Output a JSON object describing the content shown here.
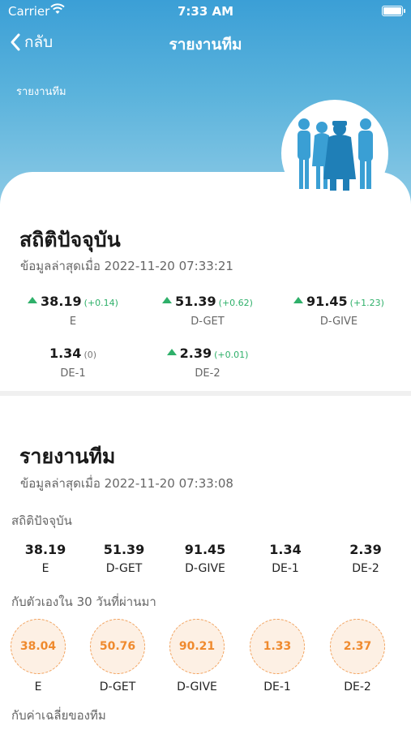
{
  "status_bar": {
    "carrier": "Carrier",
    "time": "7:33 AM"
  },
  "nav": {
    "back_label": "กลับ",
    "title": "รายงานทีม"
  },
  "hero": {
    "label": "รายงานทีม"
  },
  "current_stats": {
    "title": "สถิติปัจจุบัน",
    "updated": "ข้อมูลล่าสุดเมื่อ 2022-11-20 07:33:21",
    "items": [
      {
        "value": "38.19",
        "delta": "(+0.14)",
        "label": "E",
        "trend": "up"
      },
      {
        "value": "51.39",
        "delta": "(+0.62)",
        "label": "D-GET",
        "trend": "up"
      },
      {
        "value": "91.45",
        "delta": "(+1.23)",
        "label": "D-GIVE",
        "trend": "up"
      },
      {
        "value": "1.34",
        "delta": "(0)",
        "label": "DE-1",
        "trend": "none"
      },
      {
        "value": "2.39",
        "delta": "(+0.01)",
        "label": "DE-2",
        "trend": "up"
      }
    ]
  },
  "team_report": {
    "title": "รายงานทีม",
    "updated": "ข้อมูลล่าสุดเมื่อ 2022-11-20 07:33:08",
    "current_heading": "สถิติปัจจุบัน",
    "current": [
      {
        "value": "38.19",
        "label": "E"
      },
      {
        "value": "51.39",
        "label": "D-GET"
      },
      {
        "value": "91.45",
        "label": "D-GIVE"
      },
      {
        "value": "1.34",
        "label": "DE-1"
      },
      {
        "value": "2.39",
        "label": "DE-2"
      }
    ],
    "self_heading": "กับตัวเองใน 30 วันที่ผ่านมา",
    "self": [
      {
        "value": "38.04",
        "label": "E"
      },
      {
        "value": "50.76",
        "label": "D-GET"
      },
      {
        "value": "90.21",
        "label": "D-GIVE"
      },
      {
        "value": "1.33",
        "label": "DE-1"
      },
      {
        "value": "2.37",
        "label": "DE-2"
      }
    ],
    "team_avg_heading": "กับค่าเฉลี่ยของทีม"
  },
  "colors": {
    "header": "#3b9fd6",
    "up": "#2fb06a",
    "orange": "#ef8a2e"
  },
  "icons": [
    "wifi-icon",
    "battery-icon",
    "back-chevron-icon",
    "team-people-illustration",
    "arrow-up-icon"
  ]
}
